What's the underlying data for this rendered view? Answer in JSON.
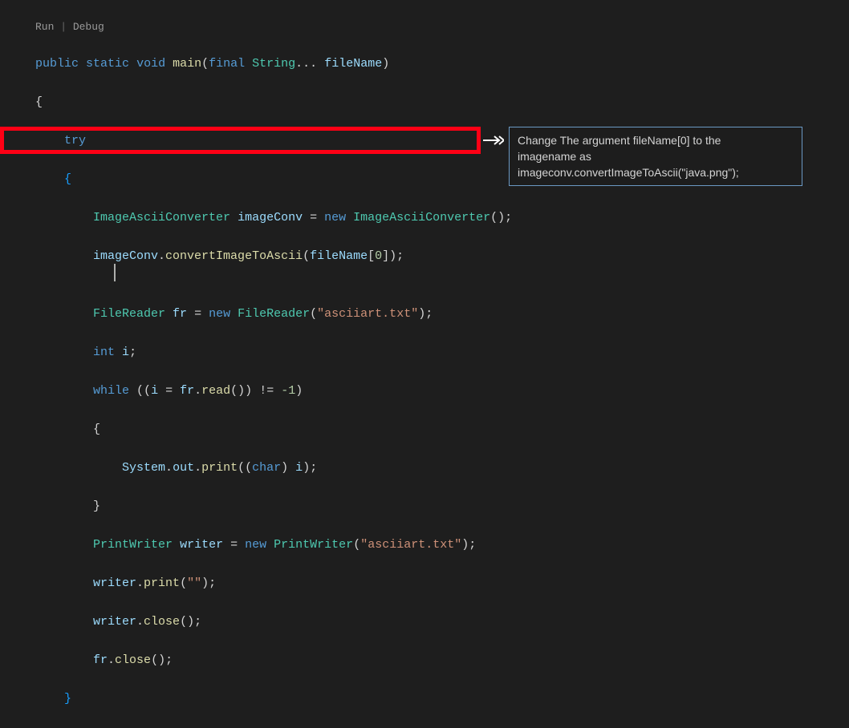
{
  "codelens": {
    "run": "Run",
    "sep": " | ",
    "debug": "Debug"
  },
  "code": {
    "l1": {
      "public": "public",
      "static": "static",
      "void": "void",
      "main": "main",
      "final": "final",
      "string": "String",
      "dots": "...",
      "filename": "fileName"
    },
    "l3": {
      "try": "try"
    },
    "l5": {
      "type": "ImageAsciiConverter",
      "var": "imageConv",
      "eq": " = ",
      "new": "new",
      "ctor": "ImageAsciiConverter"
    },
    "l6": {
      "obj": "imageConv",
      "dot": ".",
      "fn": "convertImageToAscii",
      "arg": "fileName",
      "idx": "0"
    },
    "l8": {
      "type": "FileReader",
      "var": "fr",
      "new": "new",
      "ctor": "FileReader",
      "str": "\"asciiart.txt\""
    },
    "l9": {
      "int": "int",
      "var": "i"
    },
    "l10": {
      "while": "while",
      "var": "i",
      "obj": "fr",
      "fn": "read",
      "neg1": "-1"
    },
    "l12": {
      "sys": "System",
      "out": "out",
      "print": "print",
      "char": "char",
      "var": "i"
    },
    "l14": {
      "type": "PrintWriter",
      "var": "writer",
      "new": "new",
      "ctor": "PrintWriter",
      "str": "\"asciiart.txt\""
    },
    "l15": {
      "obj": "writer",
      "fn": "print",
      "str": "\"\""
    },
    "l16": {
      "obj": "writer",
      "fn": "close"
    },
    "l17": {
      "obj": "fr",
      "fn": "close"
    }
  },
  "tooltip": {
    "line1": "Change The argument fileName[0] to the",
    "line2": "imagename as",
    "line3": "imageconv.convertImageToAscii(\"java.png\");"
  }
}
